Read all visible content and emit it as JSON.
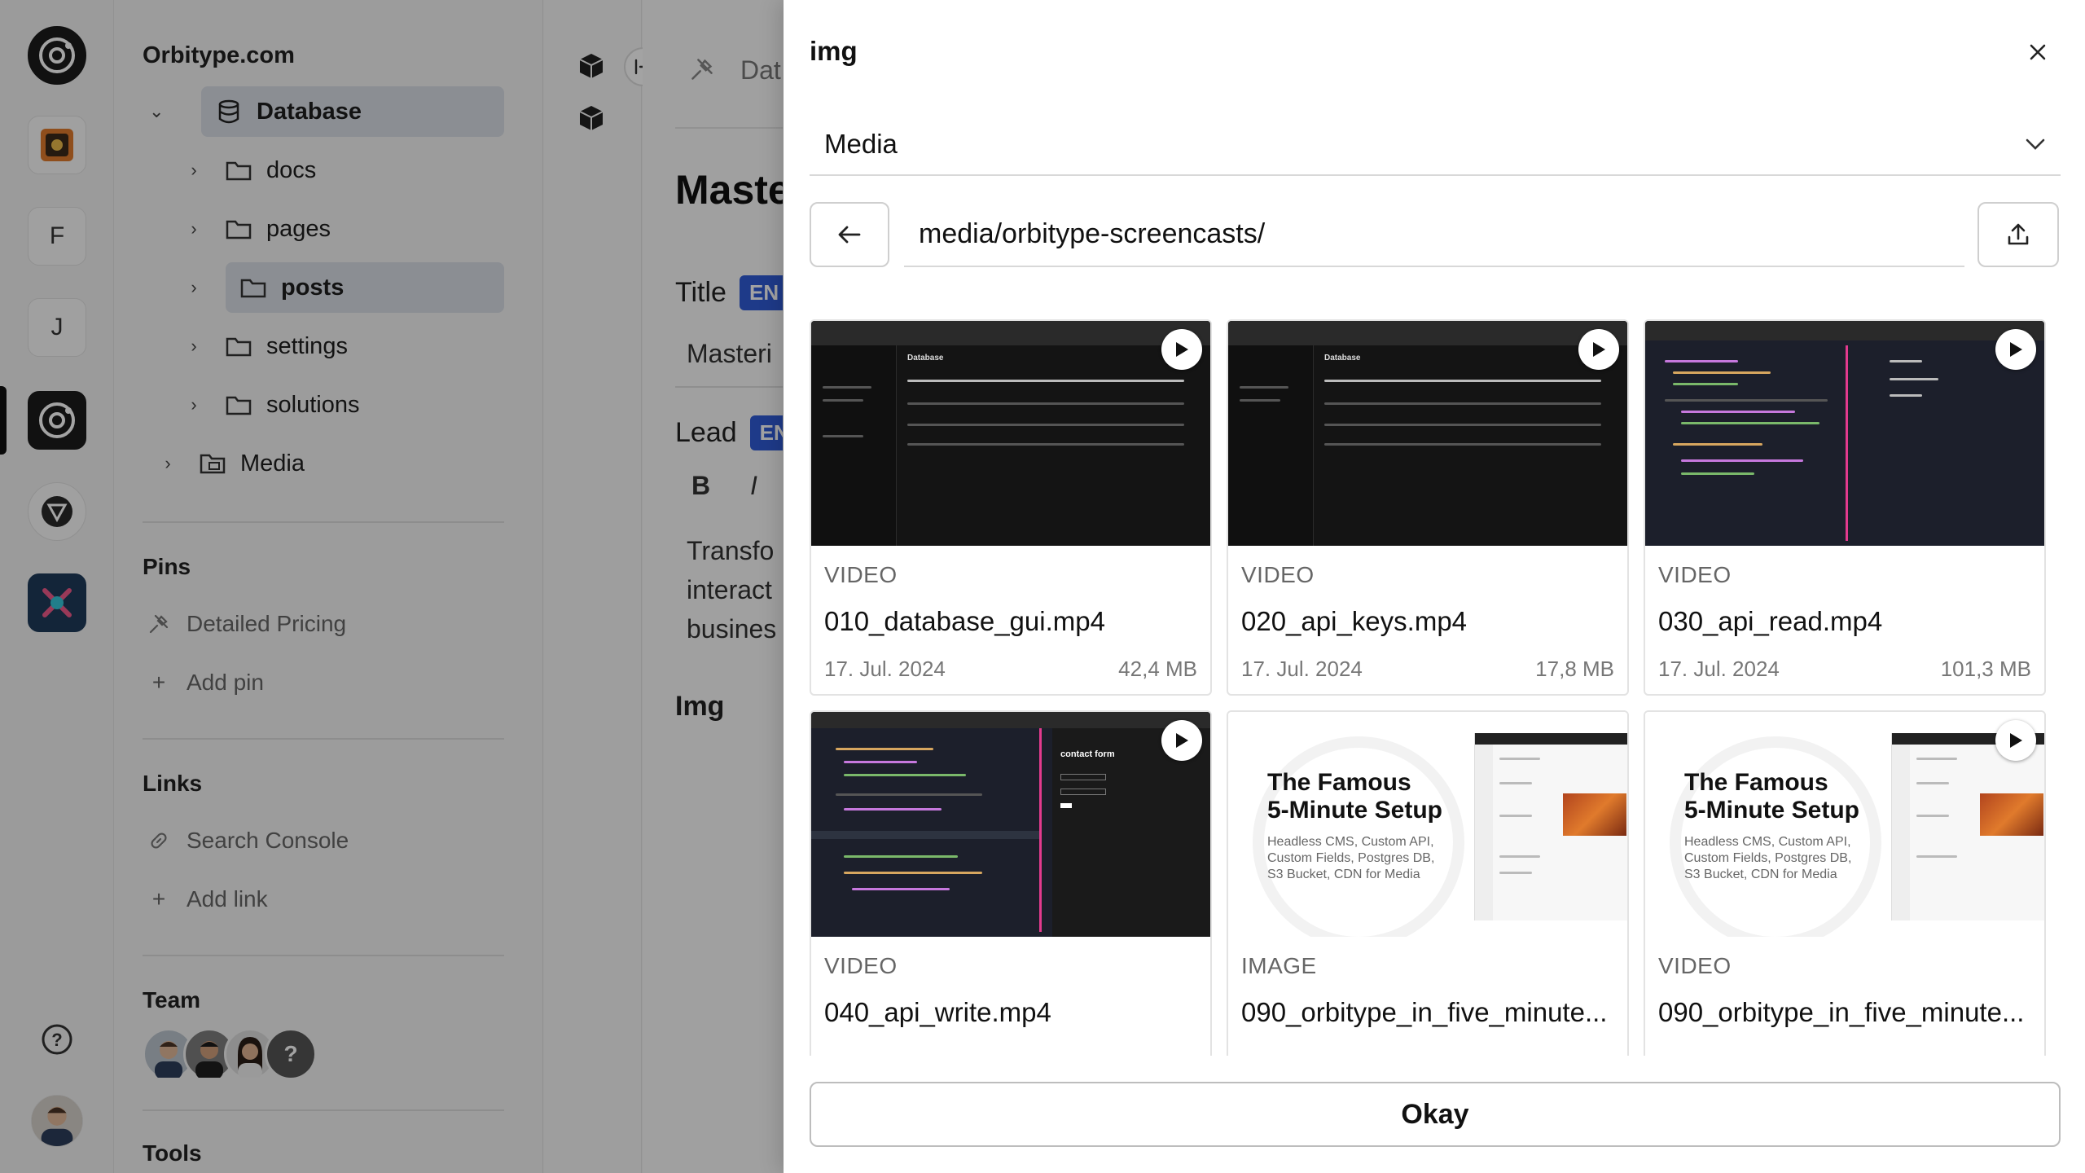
{
  "rail": {
    "letter_f": "F",
    "letter_j": "J",
    "help_symbol": "?"
  },
  "tree": {
    "site_title": "Orbitype.com",
    "root": {
      "label": "Database"
    },
    "folders": [
      {
        "label": "docs"
      },
      {
        "label": "pages"
      },
      {
        "label": "posts"
      },
      {
        "label": "settings"
      },
      {
        "label": "solutions"
      }
    ],
    "media": {
      "label": "Media"
    },
    "pins_title": "Pins",
    "pins": [
      {
        "label": "Detailed Pricing"
      }
    ],
    "add_pin": "Add pin",
    "links_title": "Links",
    "links": [
      {
        "label": "Search Console"
      }
    ],
    "add_link": "Add link",
    "team_title": "Team",
    "team_more": "?",
    "tools_title": "Tools"
  },
  "editor": {
    "breadcrumb": "Dat",
    "heading": "Maste",
    "title_label": "Title",
    "title_lang": "EN",
    "title_value": "Masteri",
    "lead_label": "Lead",
    "lead_lang": "EN",
    "bold_btn": "B",
    "italic_btn": "I",
    "lead_lines": [
      "Transfo",
      "interact",
      "busines"
    ],
    "img_label": "Img"
  },
  "modal": {
    "title": "img",
    "source_select": "Media",
    "path": "media/orbitype-screencasts/",
    "okay_label": "Okay",
    "thumb_text": {
      "database_header": "Database",
      "contact_form": "contact form",
      "famous_title_1": "The Famous",
      "famous_title_2": "5-Minute Setup",
      "famous_sub_1": "Headless CMS, Custom API,",
      "famous_sub_2": "Custom Fields, Postgres DB,",
      "famous_sub_3": "S3 Bucket, CDN for Media"
    },
    "files": [
      {
        "type": "VIDEO",
        "name": "010_database_gui.mp4",
        "date": "17. Jul. 2024",
        "size": "42,4 MB"
      },
      {
        "type": "VIDEO",
        "name": "020_api_keys.mp4",
        "date": "17. Jul. 2024",
        "size": "17,8 MB"
      },
      {
        "type": "VIDEO",
        "name": "030_api_read.mp4",
        "date": "17. Jul. 2024",
        "size": "101,3 MB"
      },
      {
        "type": "VIDEO",
        "name": "040_api_write.mp4",
        "date": "",
        "size": ""
      },
      {
        "type": "IMAGE",
        "name": "090_orbitype_in_five_minute...",
        "date": "",
        "size": ""
      },
      {
        "type": "VIDEO",
        "name": "090_orbitype_in_five_minute...",
        "date": "",
        "size": ""
      }
    ]
  },
  "colors": {
    "accent_blue": "#2f5bd6",
    "selected_row": "#d9dee7",
    "overlay": "rgba(0,0,0,0.36)"
  }
}
